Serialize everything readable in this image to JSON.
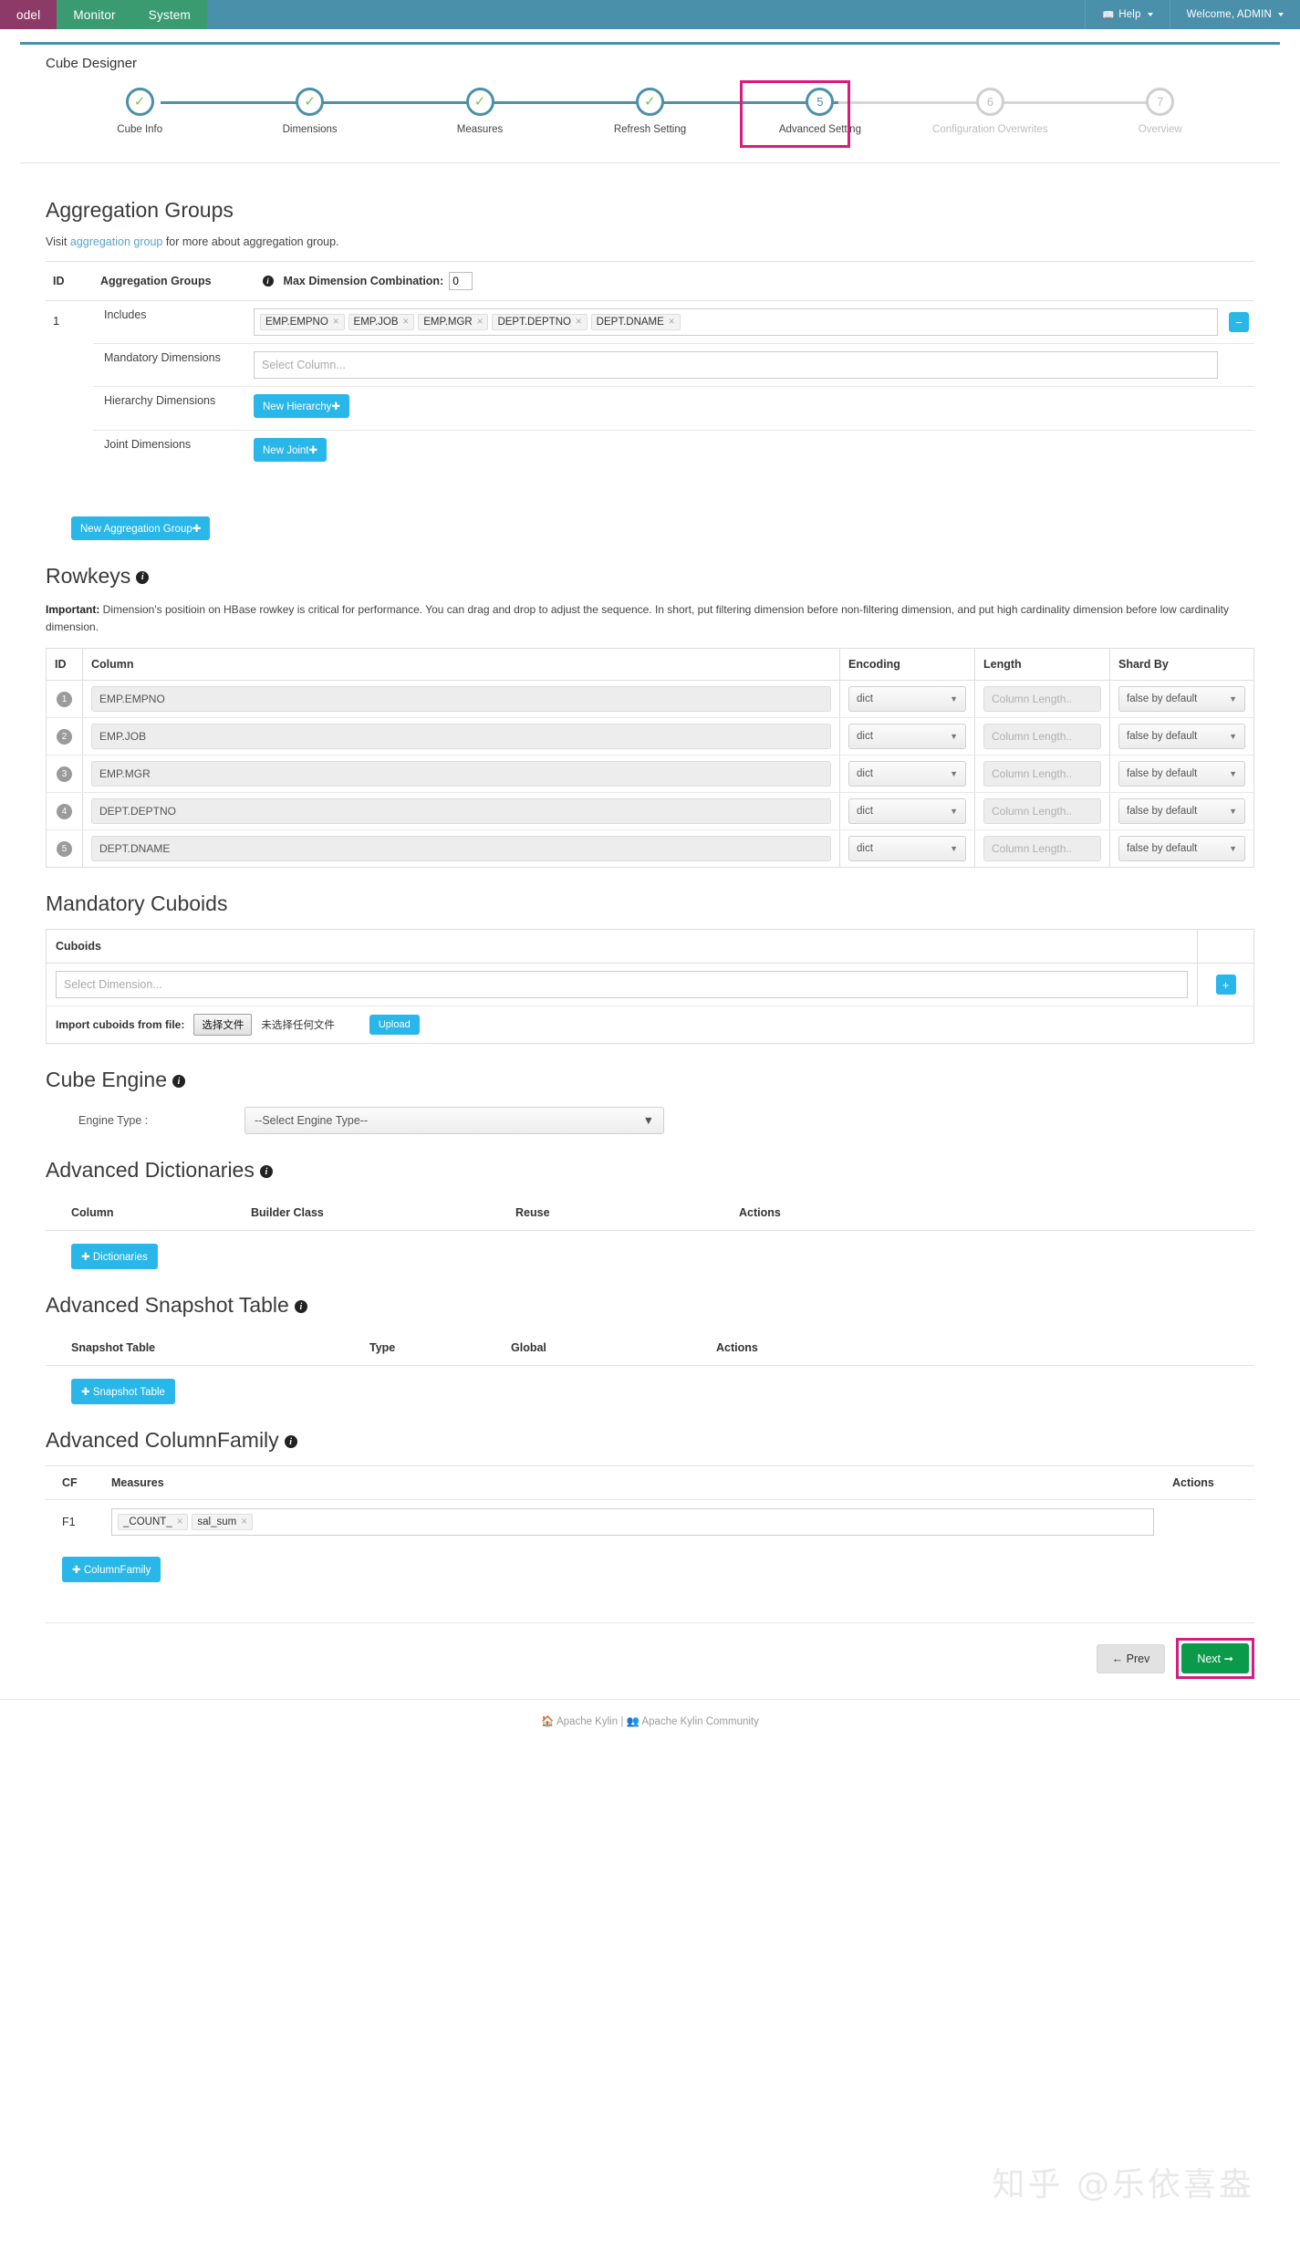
{
  "navbar": {
    "left_items": [
      {
        "label": "odel",
        "style": "model"
      },
      {
        "label": "Monitor",
        "style": "green"
      },
      {
        "label": "System",
        "style": "green"
      }
    ],
    "help_label": "Help",
    "welcome_label": "Welcome, ADMIN"
  },
  "page_title": "Cube Designer",
  "steps": [
    {
      "num": "1",
      "label": "Cube Info",
      "state": "done"
    },
    {
      "num": "2",
      "label": "Dimensions",
      "state": "done"
    },
    {
      "num": "3",
      "label": "Measures",
      "state": "done"
    },
    {
      "num": "4",
      "label": "Refresh Setting",
      "state": "done"
    },
    {
      "num": "5",
      "label": "Advanced Setting",
      "state": "current"
    },
    {
      "num": "6",
      "label": "Configuration Overwrites",
      "state": "todo"
    },
    {
      "num": "7",
      "label": "Overview",
      "state": "todo"
    }
  ],
  "aggregation": {
    "heading": "Aggregation Groups",
    "visit_prefix": "Visit ",
    "visit_link": "aggregation group",
    "visit_suffix": " for more about aggregation group.",
    "col_id": "ID",
    "col_groups": "Aggregation Groups",
    "max_dim_label": "Max Dimension Combination:",
    "max_dim_value": "0",
    "row_id": "1",
    "includes_label": "Includes",
    "includes_tags": [
      "EMP.EMPNO",
      "EMP.JOB",
      "EMP.MGR",
      "DEPT.DEPTNO",
      "DEPT.DNAME"
    ],
    "mandatory_label": "Mandatory Dimensions",
    "mandatory_placeholder": "Select Column...",
    "hierarchy_label": "Hierarchy Dimensions",
    "hierarchy_button": "New Hierarchy",
    "joint_label": "Joint Dimensions",
    "joint_button": "New Joint",
    "new_group_button": "New Aggregation Group",
    "remove_icon": "−"
  },
  "rowkeys": {
    "heading": "Rowkeys",
    "important_bold": "Important:",
    "important_text": " Dimension's positioin on HBase rowkey is critical for performance. You can drag and drop to adjust the sequence. In short, put filtering dimension before non-filtering dimension, and put high cardinality dimension before low cardinality dimension.",
    "headers": [
      "ID",
      "Column",
      "Encoding",
      "Length",
      "Shard By"
    ],
    "length_placeholder": "Column Length..",
    "rows": [
      {
        "id": "1",
        "column": "EMP.EMPNO",
        "encoding": "dict",
        "length": "",
        "shard": "false by default"
      },
      {
        "id": "2",
        "column": "EMP.JOB",
        "encoding": "dict",
        "length": "",
        "shard": "false by default"
      },
      {
        "id": "3",
        "column": "EMP.MGR",
        "encoding": "dict",
        "length": "",
        "shard": "false by default"
      },
      {
        "id": "4",
        "column": "DEPT.DEPTNO",
        "encoding": "dict",
        "length": "",
        "shard": "false by default"
      },
      {
        "id": "5",
        "column": "DEPT.DNAME",
        "encoding": "dict",
        "length": "",
        "shard": "false by default"
      }
    ]
  },
  "cuboids": {
    "heading": "Mandatory Cuboids",
    "col_cuboids": "Cuboids",
    "select_placeholder": "Select Dimension...",
    "add_icon": "+",
    "import_label": "Import cuboids from file:",
    "file_button": "选择文件",
    "file_status": "未选择任何文件",
    "upload_button": "Upload"
  },
  "engine": {
    "heading": "Cube Engine",
    "type_label": "Engine Type :",
    "selected": "--Select Engine Type--"
  },
  "dictionaries": {
    "heading": "Advanced Dictionaries",
    "headers": [
      "Column",
      "Builder Class",
      "Reuse",
      "Actions"
    ],
    "add_button": "Dictionaries"
  },
  "snapshot": {
    "heading": "Advanced Snapshot Table",
    "headers": [
      "Snapshot Table",
      "Type",
      "Global",
      "Actions"
    ],
    "add_button": "Snapshot Table"
  },
  "columnfamily": {
    "heading": "Advanced ColumnFamily",
    "headers": [
      "CF",
      "Measures",
      "Actions"
    ],
    "rows": [
      {
        "cf": "F1",
        "measures": [
          "_COUNT_",
          "sal_sum"
        ]
      }
    ],
    "add_button": "ColumnFamily"
  },
  "footer_buttons": {
    "prev": "Prev",
    "next": "Next"
  },
  "footer": {
    "link1": "Apache Kylin",
    "sep": "|",
    "link2": "Apache Kylin Community"
  },
  "watermark": "知乎 @乐依喜盎",
  "colors": {
    "nav_bg": "#4a90ab",
    "nav_model": "#8e3a68",
    "nav_green": "#3a9a70",
    "accent_cyan": "#29b6e8",
    "highlight_pink": "#d81b7e",
    "next_green": "#0a9a4a",
    "step_blue": "#4a90ab",
    "check_green": "#7dc242"
  }
}
